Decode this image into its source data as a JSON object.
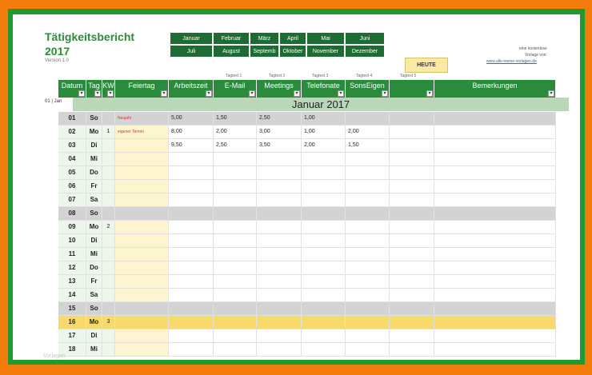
{
  "header": {
    "title": "Tätigkeitsbericht",
    "year": "2017",
    "version": "Version 1.0",
    "note_line1": "eine kostenlose",
    "note_line2": "Vorlage von:",
    "link": "www.alle-meine-vorlagen.de",
    "heute_label": "HEUTE"
  },
  "months_row1": [
    "Januar",
    "Februar",
    "März",
    "April",
    "Mai",
    "Juni"
  ],
  "months_row2": [
    "Juli",
    "August",
    "Septemb",
    "Oktober",
    "November",
    "Dezember"
  ],
  "tag_labels": [
    "Tagtext 1",
    "Tagtext 2",
    "Tagtext 3",
    "Tagtext 4",
    "Tagtext 5"
  ],
  "columns": [
    "Datum",
    "Tag",
    "KW",
    "Feiertag",
    "Arbeitszeit",
    "E-Mail",
    "Meetings",
    "Telefonate",
    "SonsEigen",
    "",
    "Bemerkungen"
  ],
  "month_title": "Januar 2017",
  "side_label": "01 | Jan",
  "watermark": "Vorlagen",
  "rows": [
    {
      "date": "01",
      "day": "So",
      "kw": "",
      "feiertag": "Neujahr",
      "arbeit": "5,00",
      "email": "1,50",
      "meet": "2,50",
      "tel": "1,00",
      "sons": "",
      "type": "weekend"
    },
    {
      "date": "02",
      "day": "Mo",
      "kw": "1",
      "feiertag": "eigener Termin",
      "arbeit": "8,00",
      "email": "2,00",
      "meet": "3,00",
      "tel": "1,00",
      "sons": "2,00",
      "type": "normal"
    },
    {
      "date": "03",
      "day": "Di",
      "kw": "",
      "feiertag": "",
      "arbeit": "9,50",
      "email": "2,50",
      "meet": "3,50",
      "tel": "2,00",
      "sons": "1,50",
      "type": "normal"
    },
    {
      "date": "04",
      "day": "Mi",
      "kw": "",
      "feiertag": "",
      "arbeit": "",
      "email": "",
      "meet": "",
      "tel": "",
      "sons": "",
      "type": "normal"
    },
    {
      "date": "05",
      "day": "Do",
      "kw": "",
      "feiertag": "",
      "arbeit": "",
      "email": "",
      "meet": "",
      "tel": "",
      "sons": "",
      "type": "normal"
    },
    {
      "date": "06",
      "day": "Fr",
      "kw": "",
      "feiertag": "",
      "arbeit": "",
      "email": "",
      "meet": "",
      "tel": "",
      "sons": "",
      "type": "normal"
    },
    {
      "date": "07",
      "day": "Sa",
      "kw": "",
      "feiertag": "",
      "arbeit": "",
      "email": "",
      "meet": "",
      "tel": "",
      "sons": "",
      "type": "normal"
    },
    {
      "date": "08",
      "day": "So",
      "kw": "",
      "feiertag": "",
      "arbeit": "",
      "email": "",
      "meet": "",
      "tel": "",
      "sons": "",
      "type": "weekend"
    },
    {
      "date": "09",
      "day": "Mo",
      "kw": "2",
      "feiertag": "",
      "arbeit": "",
      "email": "",
      "meet": "",
      "tel": "",
      "sons": "",
      "type": "normal"
    },
    {
      "date": "10",
      "day": "Di",
      "kw": "",
      "feiertag": "",
      "arbeit": "",
      "email": "",
      "meet": "",
      "tel": "",
      "sons": "",
      "type": "normal"
    },
    {
      "date": "11",
      "day": "Mi",
      "kw": "",
      "feiertag": "",
      "arbeit": "",
      "email": "",
      "meet": "",
      "tel": "",
      "sons": "",
      "type": "normal"
    },
    {
      "date": "12",
      "day": "Do",
      "kw": "",
      "feiertag": "",
      "arbeit": "",
      "email": "",
      "meet": "",
      "tel": "",
      "sons": "",
      "type": "normal"
    },
    {
      "date": "13",
      "day": "Fr",
      "kw": "",
      "feiertag": "",
      "arbeit": "",
      "email": "",
      "meet": "",
      "tel": "",
      "sons": "",
      "type": "normal"
    },
    {
      "date": "14",
      "day": "Sa",
      "kw": "",
      "feiertag": "",
      "arbeit": "",
      "email": "",
      "meet": "",
      "tel": "",
      "sons": "",
      "type": "normal"
    },
    {
      "date": "15",
      "day": "So",
      "kw": "",
      "feiertag": "",
      "arbeit": "",
      "email": "",
      "meet": "",
      "tel": "",
      "sons": "",
      "type": "weekend"
    },
    {
      "date": "16",
      "day": "Mo",
      "kw": "3",
      "feiertag": "",
      "arbeit": "",
      "email": "",
      "meet": "",
      "tel": "",
      "sons": "",
      "type": "today"
    },
    {
      "date": "17",
      "day": "Di",
      "kw": "",
      "feiertag": "",
      "arbeit": "",
      "email": "",
      "meet": "",
      "tel": "",
      "sons": "",
      "type": "normal"
    },
    {
      "date": "18",
      "day": "Mi",
      "kw": "",
      "feiertag": "",
      "arbeit": "",
      "email": "",
      "meet": "",
      "tel": "",
      "sons": "",
      "type": "normal"
    }
  ],
  "colors": {
    "frame_orange": "#f47c0c",
    "frame_green": "#1f9a2e",
    "header_green": "#2a8b3c",
    "month_button": "#1e6b33",
    "weekend_gray": "#d3d3d3",
    "today_yellow": "#f8d96b"
  }
}
